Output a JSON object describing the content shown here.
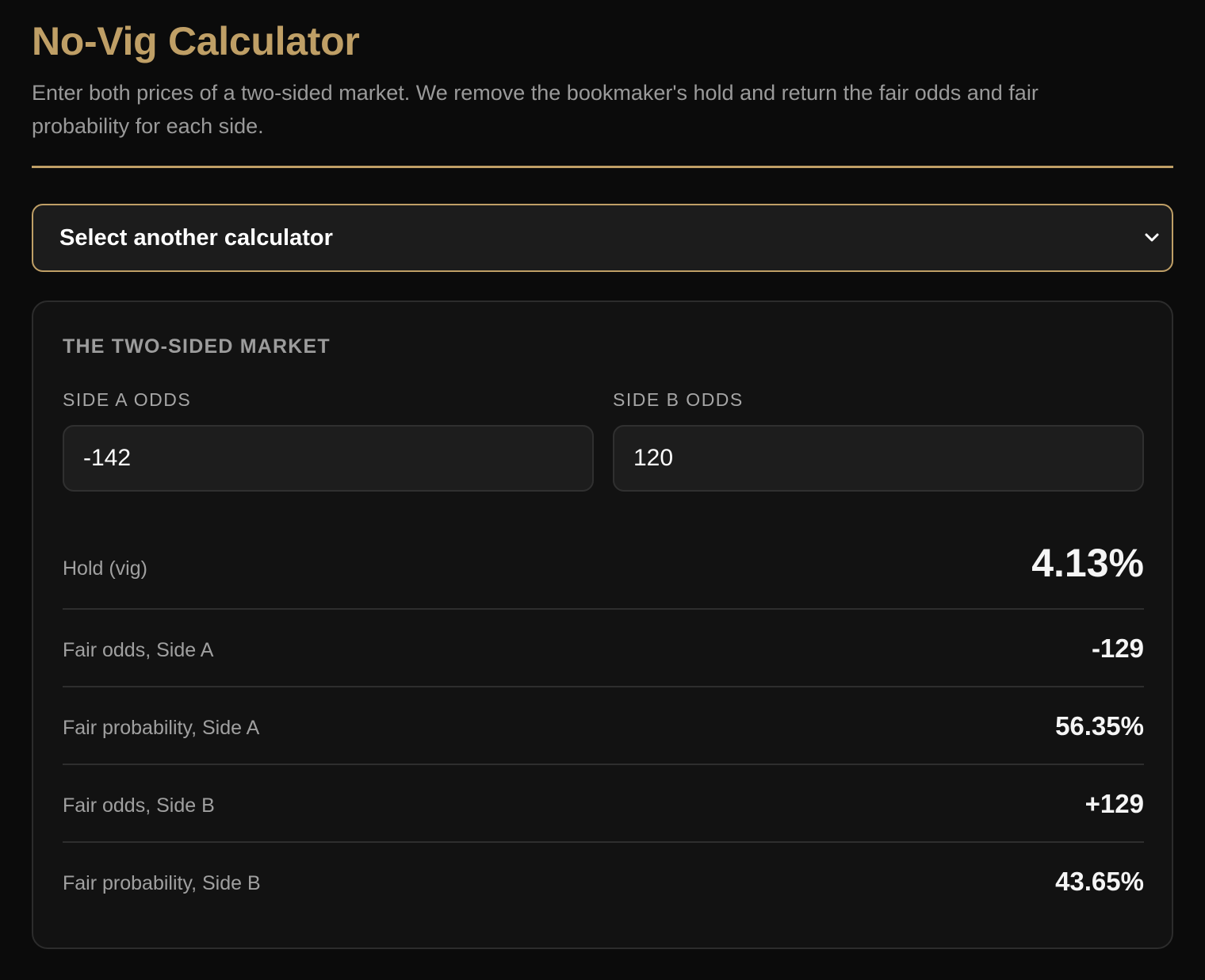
{
  "header": {
    "title": "No-Vig Calculator",
    "subtitle": "Enter both prices of a two-sided market. We remove the bookmaker's hold and return the fair odds and fair probability for each side."
  },
  "calculator_select": {
    "selected_label": "Select another calculator"
  },
  "market": {
    "section_title": "THE TWO-SIDED MARKET",
    "side_a": {
      "label": "SIDE A ODDS",
      "value": "-142"
    },
    "side_b": {
      "label": "SIDE B ODDS",
      "value": "120"
    }
  },
  "results": [
    {
      "label": "Hold (vig)",
      "value": "4.13%"
    },
    {
      "label": "Fair odds, Side A",
      "value": "-129"
    },
    {
      "label": "Fair probability, Side A",
      "value": "56.35%"
    },
    {
      "label": "Fair odds, Side B",
      "value": "+129"
    },
    {
      "label": "Fair probability, Side B",
      "value": "43.65%"
    }
  ],
  "theme": {
    "accent": "#bf9f66",
    "background": "#0b0b0b",
    "card": "#121212"
  },
  "icons": {
    "select_chevron": "chevron-down-icon"
  }
}
